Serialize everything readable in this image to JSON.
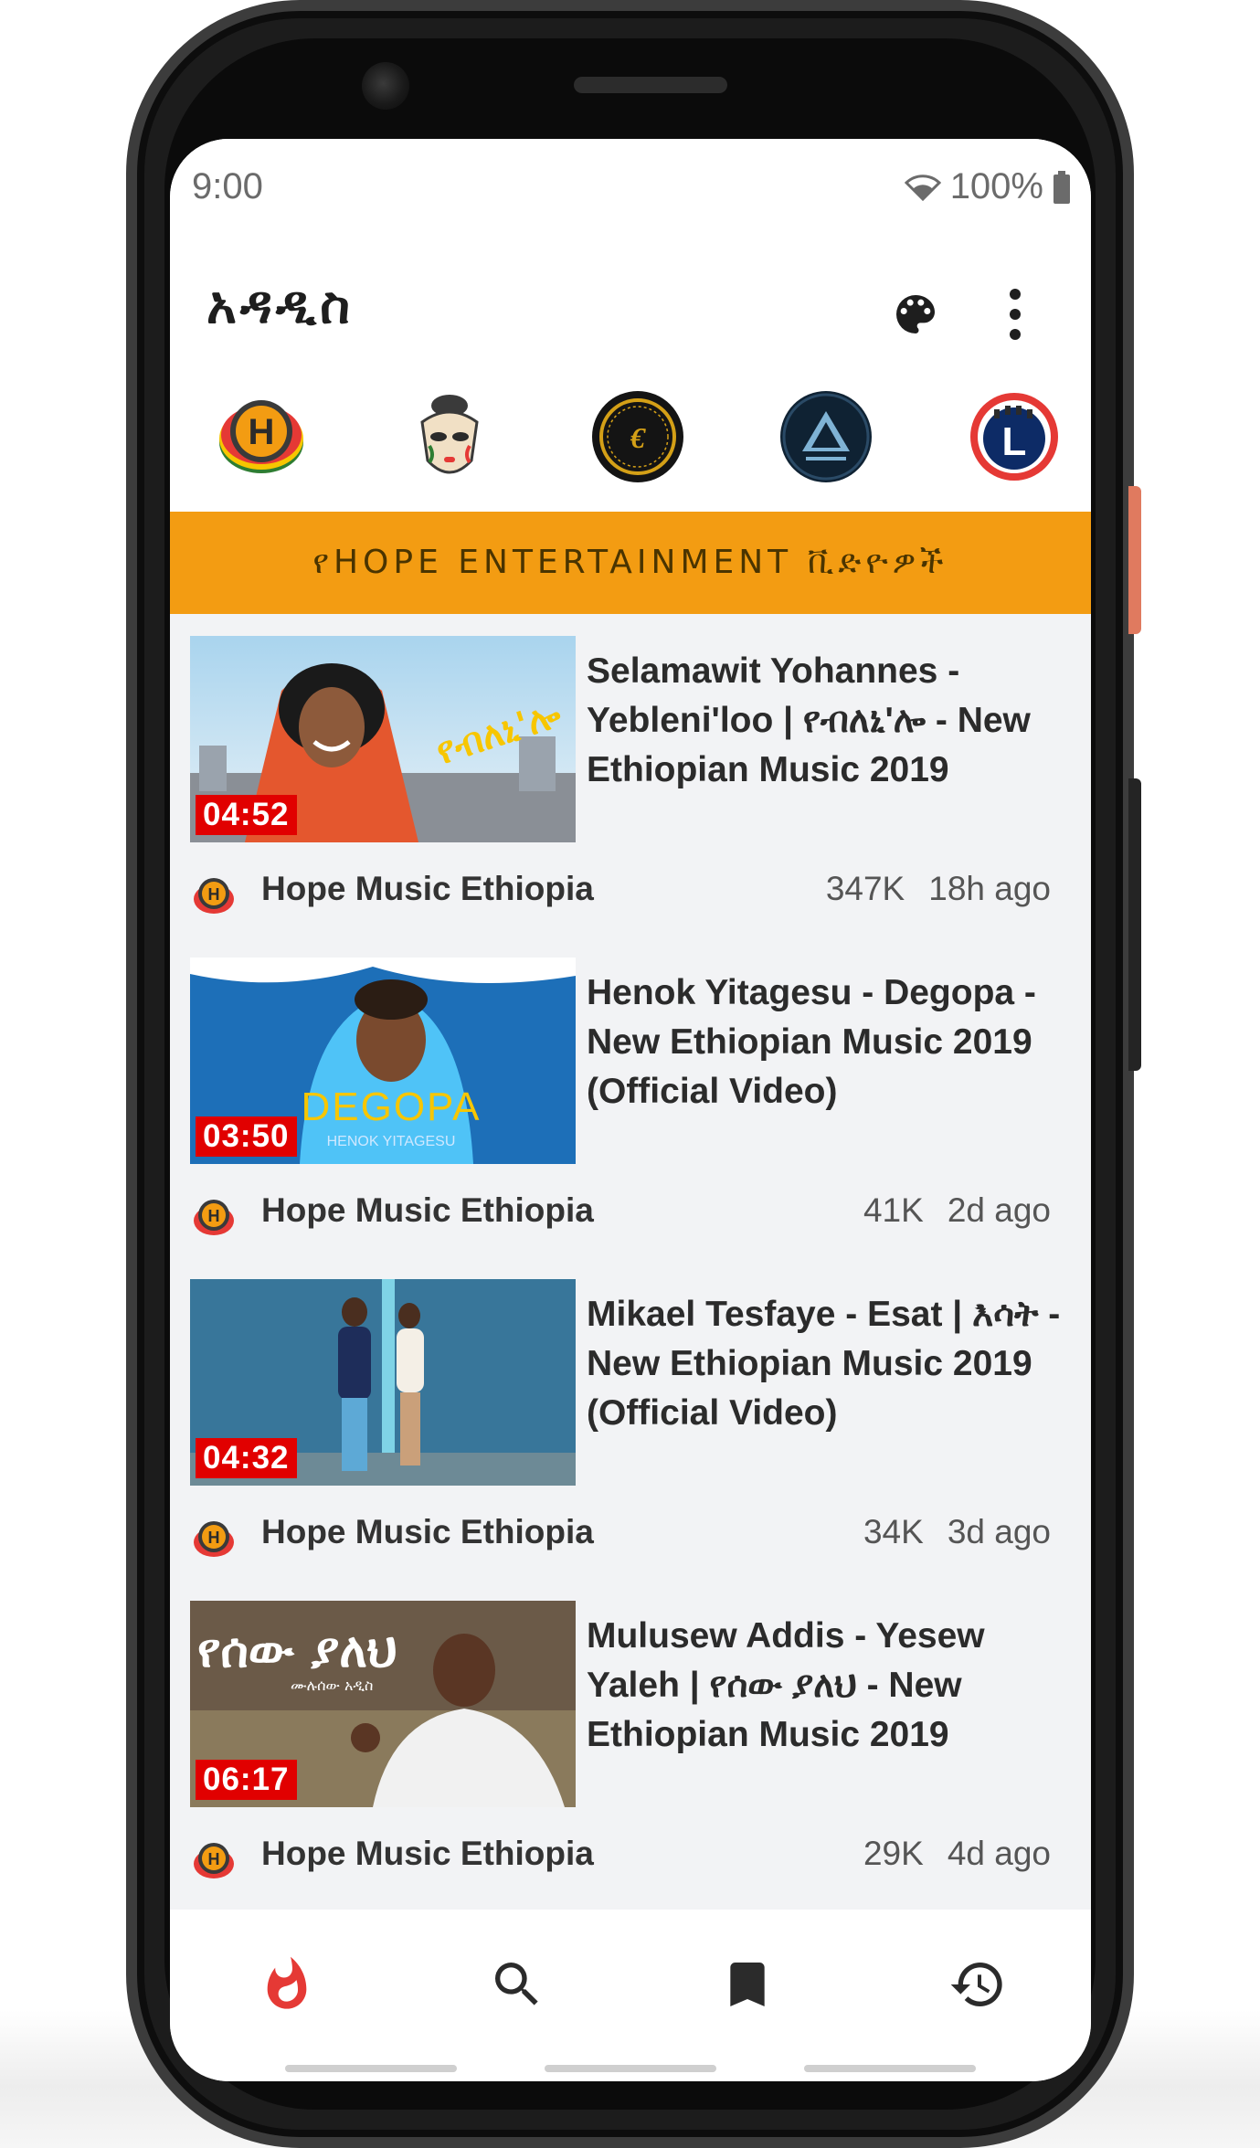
{
  "status_bar": {
    "time": "9:00",
    "battery": "100%"
  },
  "app_bar": {
    "title": "አዳዲስ",
    "palette_icon": "palette-icon",
    "menu_icon": "more-vert-icon"
  },
  "channels": [
    {
      "name": "hope-channel",
      "icon": "hope-logo"
    },
    {
      "name": "mask-channel",
      "icon": "mask-logo"
    },
    {
      "name": "gold-channel",
      "icon": "gold-emblem-logo"
    },
    {
      "name": "triangle-channel",
      "icon": "triangle-logo"
    },
    {
      "name": "l-channel",
      "icon": "letter-l-logo"
    }
  ],
  "banner": {
    "text": "የHOPE ENTERTAINMENT ቪድዮዎች",
    "color": "#f39c12"
  },
  "videos": [
    {
      "duration": "04:52",
      "title": "Selamawit Yohannes - Yebleni'loo | የብለኒ'ሎ - New Ethiopian Music 2019",
      "channel": "Hope Music Ethiopia",
      "views": "347K",
      "age": "18h ago"
    },
    {
      "duration": "03:50",
      "title": "Henok Yitagesu - Degopa - New Ethiopian Music 2019 (Official Video)",
      "channel": "Hope Music Ethiopia",
      "views": "41K",
      "age": "2d ago"
    },
    {
      "duration": "04:32",
      "title": "Mikael Tesfaye - Esat | እሳት - New Ethiopian Music 2019 (Official Video)",
      "channel": "Hope Music Ethiopia",
      "views": "34K",
      "age": "3d ago"
    },
    {
      "duration": "06:17",
      "title": "Mulusew Addis - Yesew Yaleh | የሰው ያለህ - New Ethiopian Music 2019",
      "channel": "Hope Music Ethiopia",
      "views": "29K",
      "age": "4d ago"
    }
  ],
  "bottom_nav": [
    {
      "icon": "fire-icon",
      "active": true,
      "color": "#e53935"
    },
    {
      "icon": "search-icon",
      "active": false
    },
    {
      "icon": "bookmark-icon",
      "active": false
    },
    {
      "icon": "history-icon",
      "active": false
    }
  ],
  "colors": {
    "accent": "#f39c12",
    "duration_badge": "#e10000",
    "active_nav": "#e53935"
  }
}
